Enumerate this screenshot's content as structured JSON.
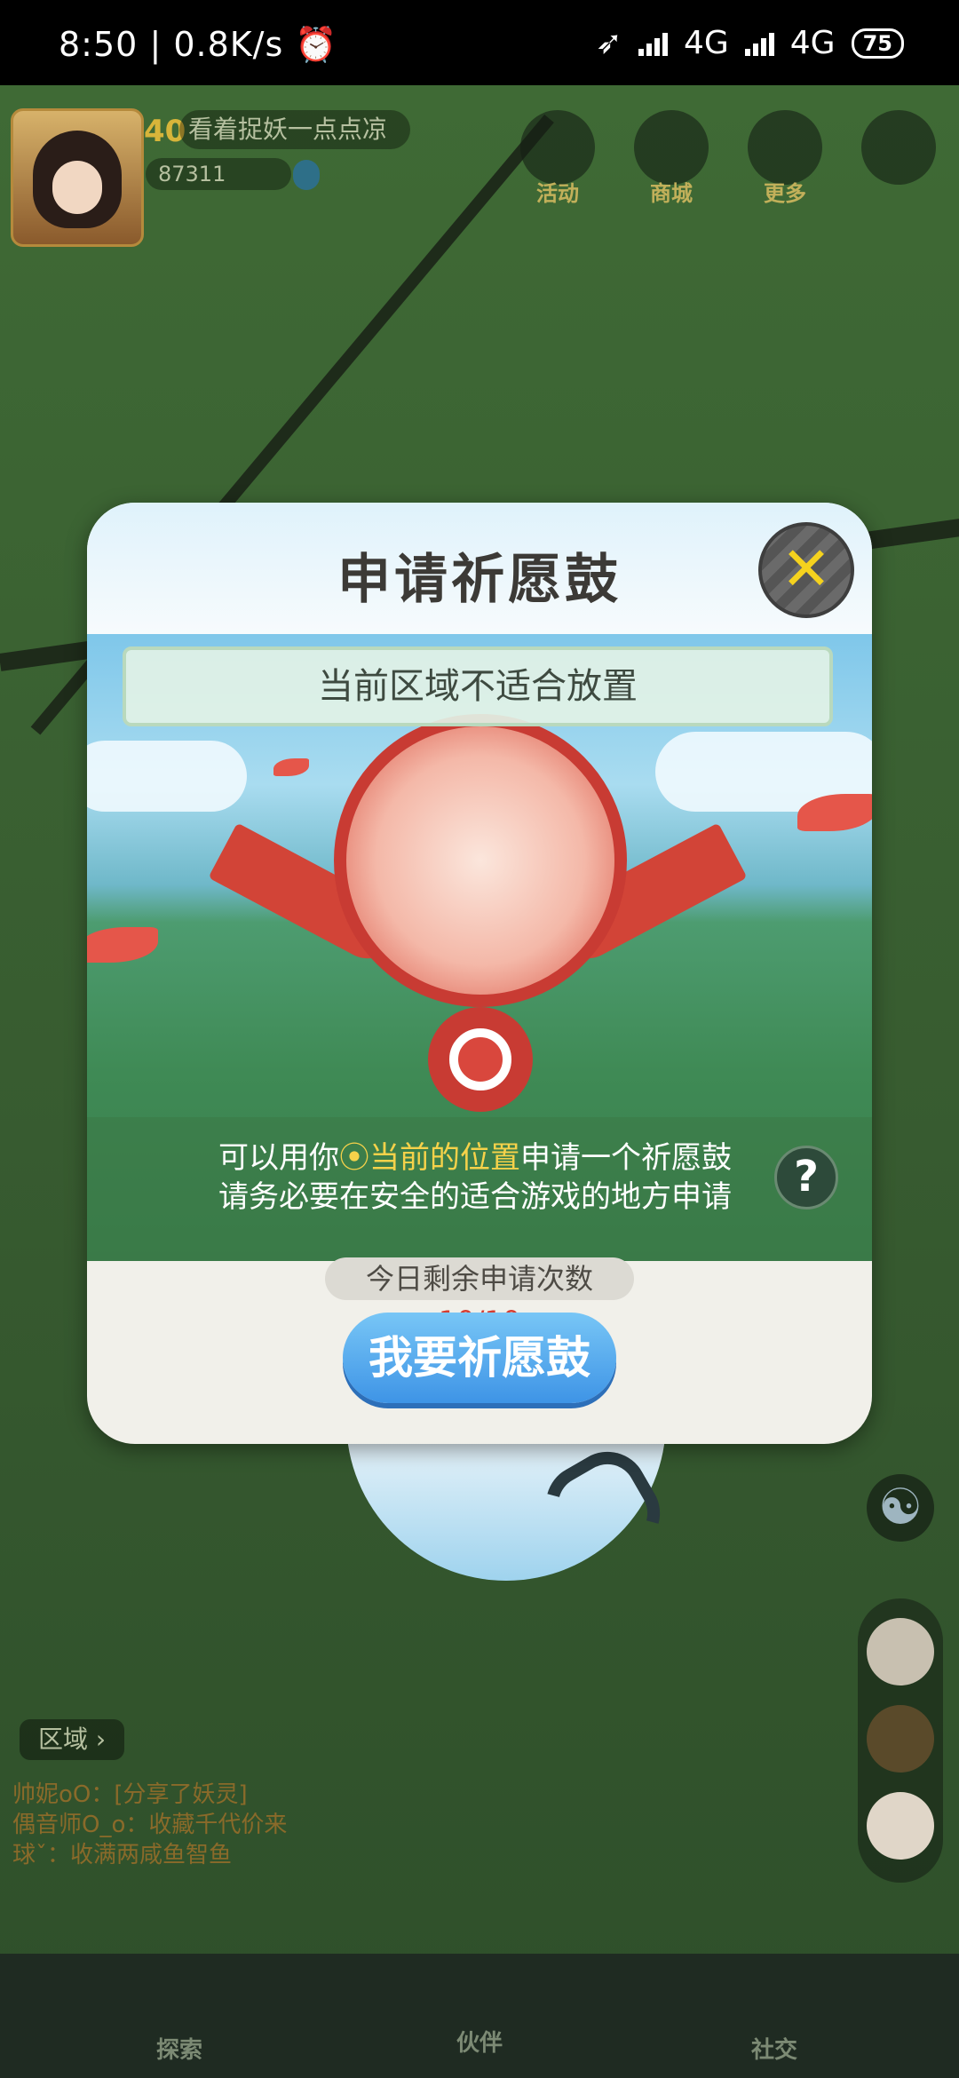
{
  "status_bar": {
    "time": "8:50",
    "net_speed": "0.8K/s",
    "net1": "4G",
    "net2": "4G",
    "battery": "75"
  },
  "game": {
    "level": "40",
    "player_name": "看着捉妖一点点凉",
    "coins": "87311",
    "top_menu": [
      "活动",
      "商城",
      "更多"
    ],
    "region_label": "区域",
    "chat": [
      "帅妮oO：[分享了妖灵]",
      "偶音师O_o：收藏千代价来",
      "球ˇ：收满两咸鱼智鱼"
    ],
    "bottom_nav": [
      "探索",
      "伙伴",
      "社交"
    ]
  },
  "dialog": {
    "title": "申请祈愿鼓",
    "close_icon": "close-icon",
    "notice": "当前区域不适合放置",
    "info_line1_prefix": "可以用你",
    "info_line1_highlight": "当前的位置",
    "info_line1_suffix": "申请一个祈愿鼓",
    "info_line2": "请务必要在安全的适合游戏的地方申请",
    "remaining_label": "今日剩余申请次数",
    "remaining_count": "10/10",
    "apply_button": "我要祈愿鼓"
  },
  "colors": {
    "accent_yellow": "#f6d24a",
    "button_blue": "#3e94e6",
    "count_red": "#d53c31"
  }
}
